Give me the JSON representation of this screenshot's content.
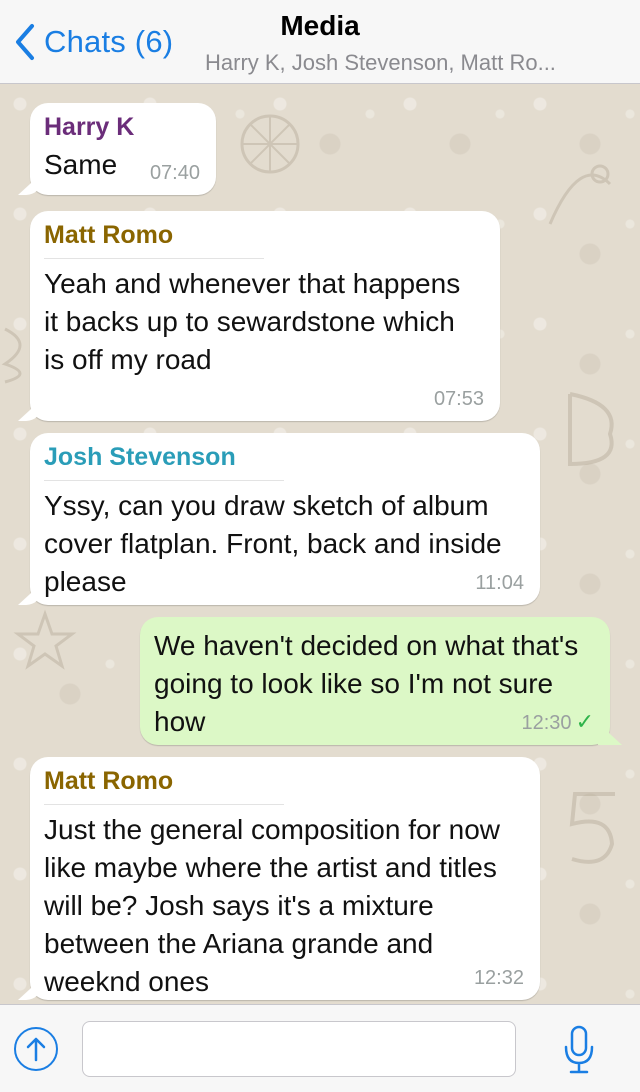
{
  "header": {
    "back_label": "Chats (6)",
    "title": "Media",
    "subtitle": "Harry K, Josh Stevenson, Matt Ro..."
  },
  "messages": [
    {
      "sender": "Harry K",
      "sender_color": "#6b2d7a",
      "text": "Same",
      "time": "07:40",
      "direction": "in"
    },
    {
      "sender": "Matt Romo",
      "sender_color": "#8a6500",
      "text": "Yeah and whenever that happens it backs up to sewardstone which is off my road",
      "time": "07:53",
      "direction": "in"
    },
    {
      "sender": "Josh Stevenson",
      "sender_color": "#2a9db8",
      "text": "Yssy, can you draw sketch of album cover flatplan. Front, back and inside please",
      "time": "11:04",
      "direction": "in"
    },
    {
      "sender": "",
      "text": "We haven't decided on what that's going to look like so I'm not sure how",
      "time": "12:30",
      "direction": "out",
      "status": "sent"
    },
    {
      "sender": "Matt Romo",
      "sender_color": "#8a6500",
      "text": "Just the general composition for now like maybe where the artist and titles will be? Josh says it's a mixture between the Ariana grande and weeknd ones",
      "time": "12:32",
      "direction": "in"
    }
  ],
  "input": {
    "value": "",
    "placeholder": ""
  },
  "colors": {
    "accent": "#1a7ee3",
    "outgoing_bubble": "#dcf8c6",
    "incoming_bubble": "#ffffff",
    "check": "#2fb34a"
  },
  "icons": [
    "chevron-left-icon",
    "upload-arrow-icon",
    "microphone-icon",
    "checkmark-icon"
  ]
}
